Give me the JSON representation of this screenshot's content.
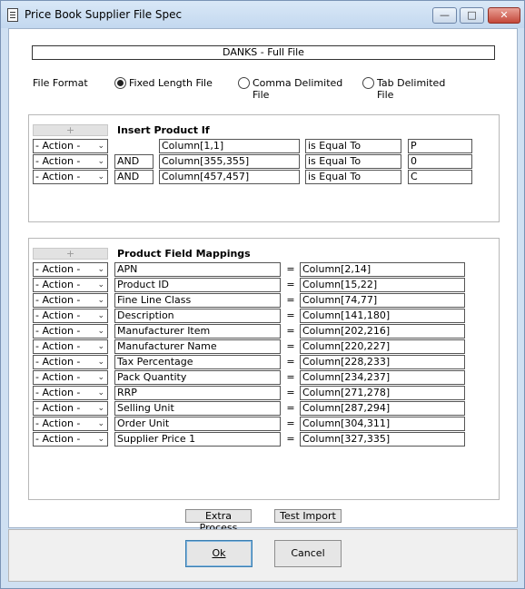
{
  "window": {
    "title": "Price Book Supplier File Spec",
    "min_glyph": "—",
    "max_glyph": "□",
    "close_glyph": "✕"
  },
  "banner": "DANKS - Full File",
  "file_format": {
    "label": "File Format",
    "options": [
      "Fixed Length File",
      "Comma Delimited File",
      "Tab Delimited File"
    ],
    "selected": "Fixed Length File"
  },
  "insert_section": {
    "title": "Insert Product If",
    "add_glyph": "+",
    "rows": [
      {
        "action": "- Action -",
        "join": "",
        "column": "Column[1,1]",
        "operator": "is Equal To",
        "value": "P"
      },
      {
        "action": "- Action -",
        "join": "AND",
        "column": "Column[355,355]",
        "operator": "is Equal To",
        "value": "0"
      },
      {
        "action": "- Action -",
        "join": "AND",
        "column": "Column[457,457]",
        "operator": "is Equal To",
        "value": "C"
      }
    ]
  },
  "mapping_section": {
    "title": "Product Field Mappings",
    "add_glyph": "+",
    "equals": "=",
    "rows": [
      {
        "action": "- Action -",
        "field": "APN",
        "column": "Column[2,14]"
      },
      {
        "action": "- Action -",
        "field": "Product ID",
        "column": "Column[15,22]"
      },
      {
        "action": "- Action -",
        "field": "Fine Line Class",
        "column": "Column[74,77]"
      },
      {
        "action": "- Action -",
        "field": "Description",
        "column": "Column[141,180]"
      },
      {
        "action": "- Action -",
        "field": "Manufacturer Item",
        "column": "Column[202,216]"
      },
      {
        "action": "- Action -",
        "field": "Manufacturer Name",
        "column": "Column[220,227]"
      },
      {
        "action": "- Action -",
        "field": "Tax Percentage",
        "column": "Column[228,233]"
      },
      {
        "action": "- Action -",
        "field": "Pack Quantity",
        "column": "Column[234,237]"
      },
      {
        "action": "- Action -",
        "field": "RRP",
        "column": "Column[271,278]"
      },
      {
        "action": "- Action -",
        "field": "Selling Unit",
        "column": "Column[287,294]"
      },
      {
        "action": "- Action -",
        "field": "Order Unit",
        "column": "Column[304,311]"
      },
      {
        "action": "- Action -",
        "field": "Supplier Price 1",
        "column": "Column[327,335]"
      }
    ]
  },
  "buttons": {
    "extra_process": "Extra Process",
    "test_import": "Test Import",
    "ok": "Ok",
    "cancel": "Cancel"
  }
}
